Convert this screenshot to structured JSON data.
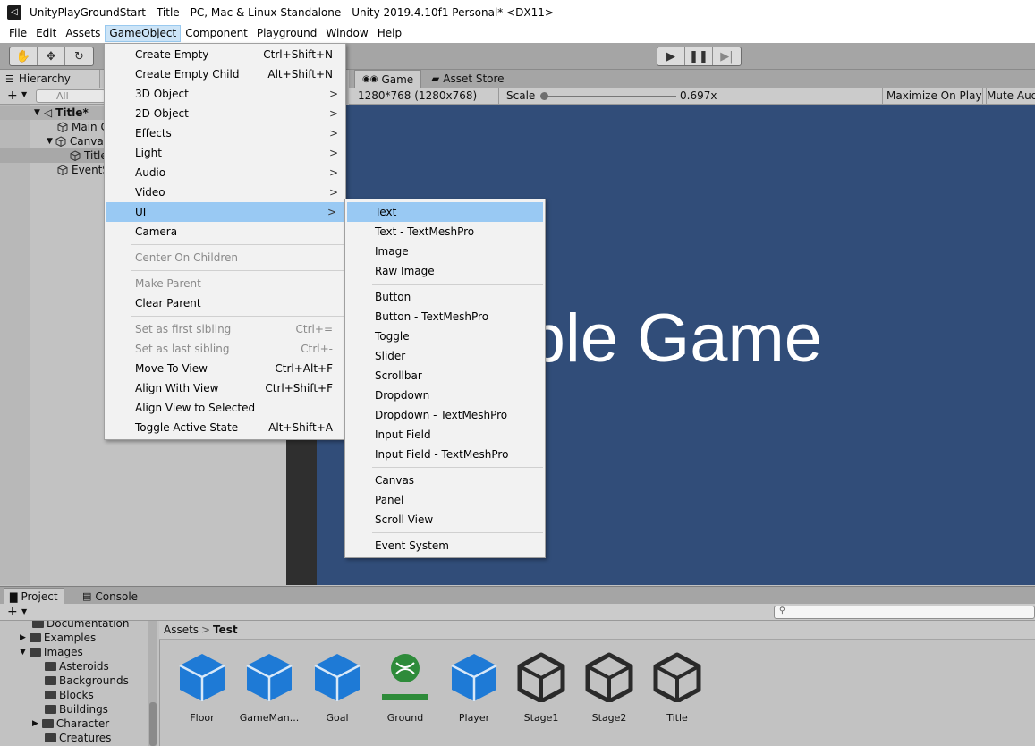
{
  "window": {
    "title": "UnityPlayGroundStart - Title - PC, Mac & Linux Standalone - Unity 2019.4.10f1 Personal* <DX11>"
  },
  "menubar": [
    "File",
    "Edit",
    "Assets",
    "GameObject",
    "Component",
    "Playground",
    "Window",
    "Help"
  ],
  "hierarchy": {
    "tab": "Hierarchy",
    "search_placeholder": "All",
    "add_label": "+",
    "items": [
      "Title*",
      "Main C",
      "Canva",
      "Title",
      "EventS"
    ]
  },
  "game": {
    "tabs": [
      "Game",
      "Asset Store"
    ],
    "resolution": "1280*768 (1280x768)",
    "scale_label": "Scale",
    "scale_value": "0.697x",
    "maximize": "Maximize On Play",
    "mute": "Mute Aud",
    "display_text": "ample Game"
  },
  "gameobject_menu": [
    {
      "label": "Create Empty",
      "shortcut": "Ctrl+Shift+N"
    },
    {
      "label": "Create Empty Child",
      "shortcut": "Alt+Shift+N"
    },
    {
      "label": "3D Object",
      "arrow": ">"
    },
    {
      "label": "2D Object",
      "arrow": ">"
    },
    {
      "label": "Effects",
      "arrow": ">"
    },
    {
      "label": "Light",
      "arrow": ">"
    },
    {
      "label": "Audio",
      "arrow": ">"
    },
    {
      "label": "Video",
      "arrow": ">"
    },
    {
      "label": "UI",
      "arrow": ">"
    },
    {
      "label": "Camera"
    },
    {
      "label": "Center On Children"
    },
    {
      "label": "Make Parent"
    },
    {
      "label": "Clear Parent"
    },
    {
      "label": "Set as first sibling",
      "shortcut": "Ctrl+="
    },
    {
      "label": "Set as last sibling",
      "shortcut": "Ctrl+-"
    },
    {
      "label": "Move To View",
      "shortcut": "Ctrl+Alt+F"
    },
    {
      "label": "Align With View",
      "shortcut": "Ctrl+Shift+F"
    },
    {
      "label": "Align View to Selected"
    },
    {
      "label": "Toggle Active State",
      "shortcut": "Alt+Shift+A"
    }
  ],
  "ui_submenu": [
    "Text",
    "Text - TextMeshPro",
    "Image",
    "Raw Image",
    "Button",
    "Button - TextMeshPro",
    "Toggle",
    "Slider",
    "Scrollbar",
    "Dropdown",
    "Dropdown - TextMeshPro",
    "Input Field",
    "Input Field - TextMeshPro",
    "Canvas",
    "Panel",
    "Scroll View",
    "Event System"
  ],
  "bottom": {
    "tabs": [
      "Project",
      "Console"
    ],
    "add_label": "+",
    "folders": [
      "Documentation",
      "Examples",
      "Images",
      "Asteroids",
      "Backgrounds",
      "Blocks",
      "Buildings",
      "Character",
      "Creatures"
    ],
    "breadcrumb": [
      "Assets",
      "Test"
    ],
    "breadcrumb_sep": ">",
    "assets": [
      "Floor",
      "GameMan...",
      "Goal",
      "Ground",
      "Player",
      "Stage1",
      "Stage2",
      "Title"
    ]
  },
  "colors": {
    "game_bg": "#314d79",
    "menu_highlight": "#99c9f3",
    "prefab_blue": "#1e7ad6",
    "ground_green": "#2e8b3a"
  }
}
